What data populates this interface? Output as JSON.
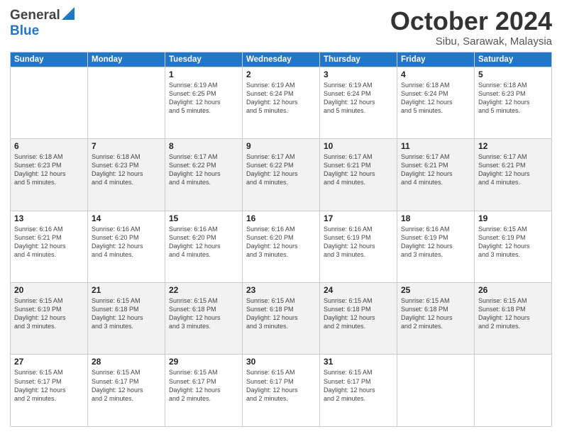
{
  "logo": {
    "line1": "General",
    "line2": "Blue"
  },
  "header": {
    "month": "October 2024",
    "location": "Sibu, Sarawak, Malaysia"
  },
  "weekdays": [
    "Sunday",
    "Monday",
    "Tuesday",
    "Wednesday",
    "Thursday",
    "Friday",
    "Saturday"
  ],
  "weeks": [
    [
      {
        "day": "",
        "info": ""
      },
      {
        "day": "",
        "info": ""
      },
      {
        "day": "1",
        "info": "Sunrise: 6:19 AM\nSunset: 6:25 PM\nDaylight: 12 hours\nand 5 minutes."
      },
      {
        "day": "2",
        "info": "Sunrise: 6:19 AM\nSunset: 6:24 PM\nDaylight: 12 hours\nand 5 minutes."
      },
      {
        "day": "3",
        "info": "Sunrise: 6:19 AM\nSunset: 6:24 PM\nDaylight: 12 hours\nand 5 minutes."
      },
      {
        "day": "4",
        "info": "Sunrise: 6:18 AM\nSunset: 6:24 PM\nDaylight: 12 hours\nand 5 minutes."
      },
      {
        "day": "5",
        "info": "Sunrise: 6:18 AM\nSunset: 6:23 PM\nDaylight: 12 hours\nand 5 minutes."
      }
    ],
    [
      {
        "day": "6",
        "info": "Sunrise: 6:18 AM\nSunset: 6:23 PM\nDaylight: 12 hours\nand 5 minutes."
      },
      {
        "day": "7",
        "info": "Sunrise: 6:18 AM\nSunset: 6:23 PM\nDaylight: 12 hours\nand 4 minutes."
      },
      {
        "day": "8",
        "info": "Sunrise: 6:17 AM\nSunset: 6:22 PM\nDaylight: 12 hours\nand 4 minutes."
      },
      {
        "day": "9",
        "info": "Sunrise: 6:17 AM\nSunset: 6:22 PM\nDaylight: 12 hours\nand 4 minutes."
      },
      {
        "day": "10",
        "info": "Sunrise: 6:17 AM\nSunset: 6:21 PM\nDaylight: 12 hours\nand 4 minutes."
      },
      {
        "day": "11",
        "info": "Sunrise: 6:17 AM\nSunset: 6:21 PM\nDaylight: 12 hours\nand 4 minutes."
      },
      {
        "day": "12",
        "info": "Sunrise: 6:17 AM\nSunset: 6:21 PM\nDaylight: 12 hours\nand 4 minutes."
      }
    ],
    [
      {
        "day": "13",
        "info": "Sunrise: 6:16 AM\nSunset: 6:21 PM\nDaylight: 12 hours\nand 4 minutes."
      },
      {
        "day": "14",
        "info": "Sunrise: 6:16 AM\nSunset: 6:20 PM\nDaylight: 12 hours\nand 4 minutes."
      },
      {
        "day": "15",
        "info": "Sunrise: 6:16 AM\nSunset: 6:20 PM\nDaylight: 12 hours\nand 4 minutes."
      },
      {
        "day": "16",
        "info": "Sunrise: 6:16 AM\nSunset: 6:20 PM\nDaylight: 12 hours\nand 3 minutes."
      },
      {
        "day": "17",
        "info": "Sunrise: 6:16 AM\nSunset: 6:19 PM\nDaylight: 12 hours\nand 3 minutes."
      },
      {
        "day": "18",
        "info": "Sunrise: 6:16 AM\nSunset: 6:19 PM\nDaylight: 12 hours\nand 3 minutes."
      },
      {
        "day": "19",
        "info": "Sunrise: 6:15 AM\nSunset: 6:19 PM\nDaylight: 12 hours\nand 3 minutes."
      }
    ],
    [
      {
        "day": "20",
        "info": "Sunrise: 6:15 AM\nSunset: 6:19 PM\nDaylight: 12 hours\nand 3 minutes."
      },
      {
        "day": "21",
        "info": "Sunrise: 6:15 AM\nSunset: 6:18 PM\nDaylight: 12 hours\nand 3 minutes."
      },
      {
        "day": "22",
        "info": "Sunrise: 6:15 AM\nSunset: 6:18 PM\nDaylight: 12 hours\nand 3 minutes."
      },
      {
        "day": "23",
        "info": "Sunrise: 6:15 AM\nSunset: 6:18 PM\nDaylight: 12 hours\nand 3 minutes."
      },
      {
        "day": "24",
        "info": "Sunrise: 6:15 AM\nSunset: 6:18 PM\nDaylight: 12 hours\nand 2 minutes."
      },
      {
        "day": "25",
        "info": "Sunrise: 6:15 AM\nSunset: 6:18 PM\nDaylight: 12 hours\nand 2 minutes."
      },
      {
        "day": "26",
        "info": "Sunrise: 6:15 AM\nSunset: 6:18 PM\nDaylight: 12 hours\nand 2 minutes."
      }
    ],
    [
      {
        "day": "27",
        "info": "Sunrise: 6:15 AM\nSunset: 6:17 PM\nDaylight: 12 hours\nand 2 minutes."
      },
      {
        "day": "28",
        "info": "Sunrise: 6:15 AM\nSunset: 6:17 PM\nDaylight: 12 hours\nand 2 minutes."
      },
      {
        "day": "29",
        "info": "Sunrise: 6:15 AM\nSunset: 6:17 PM\nDaylight: 12 hours\nand 2 minutes."
      },
      {
        "day": "30",
        "info": "Sunrise: 6:15 AM\nSunset: 6:17 PM\nDaylight: 12 hours\nand 2 minutes."
      },
      {
        "day": "31",
        "info": "Sunrise: 6:15 AM\nSunset: 6:17 PM\nDaylight: 12 hours\nand 2 minutes."
      },
      {
        "day": "",
        "info": ""
      },
      {
        "day": "",
        "info": ""
      }
    ]
  ]
}
